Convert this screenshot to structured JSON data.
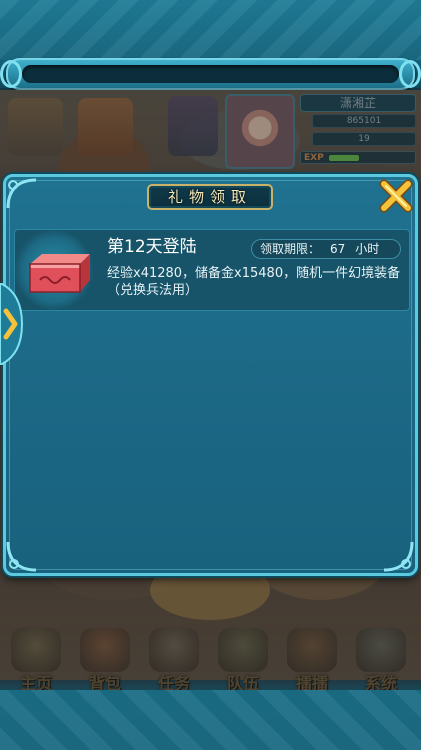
{
  "hud": {
    "player_name": "潇湘芷",
    "gold": "865101",
    "gems": "19",
    "exp_label": "EXP",
    "exp_fraction": 0.35
  },
  "dialog": {
    "title": "礼物领取",
    "item": {
      "title": "第12天登陆",
      "deadline_label": "领取期限：",
      "deadline_value": "67",
      "deadline_unit": "小时",
      "reward_text": "经验x41280，储备金x15480，随机一件幻境装备（兑换兵法用）"
    }
  },
  "bottom_nav": [
    {
      "label": "主页",
      "icon": "home-pavilion-icon"
    },
    {
      "label": "背包",
      "icon": "treasure-chest-icon"
    },
    {
      "label": "任务",
      "icon": "scroll-icon"
    },
    {
      "label": "队伍",
      "icon": "team-figure-icon"
    },
    {
      "label": "擂擂",
      "icon": "drum-icon"
    },
    {
      "label": "系统",
      "icon": "gear-icon"
    }
  ],
  "colors": {
    "frame_cyan": "#5cc9df",
    "dialog_bg": "#1f7290",
    "title_gold": "#c9b36a",
    "close_gold": "#f5c33a"
  }
}
